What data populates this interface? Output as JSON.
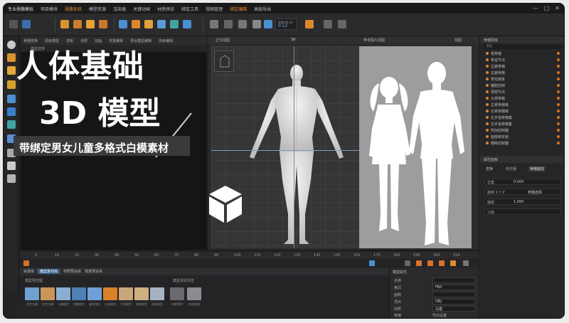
{
  "menubar": {
    "app_title": "专业骨骼模拟",
    "items": [
      "项目模块",
      "骨骼系统",
      "模型资源",
      "渲染器",
      "关键动画",
      "材质预设",
      "绑定工具",
      "视图管理",
      "绑定编辑",
      "高级导出"
    ],
    "highlight_index": 1
  },
  "toolbar": {
    "frame_display": "0:12",
    "frame_label": "帧数/00:12"
  },
  "viewport_left": {
    "tabs": [
      "骨骼变换",
      "层级模型",
      "渲染",
      "光照",
      "动画",
      "权重编辑",
      "预设模型编辑",
      "高级编辑"
    ],
    "sub_label": "模型选择"
  },
  "promo": {
    "title_line1": "人体基础",
    "title_line2": "3D 模型",
    "subtitle": "带绑定男女儿童多格式白模素材"
  },
  "viewport_main": {
    "left_label": "正交视图",
    "center_label": "3d",
    "right_label": "参考图片视图",
    "right_tag": "视图"
  },
  "outliner": {
    "title": "骨骼层级",
    "filter": "筛选",
    "items": [
      "根骨骼",
      "骨盆节点",
      "左腿骨骼",
      "右腿骨骼",
      "脊柱链条",
      "胸腔控制",
      "颈部节点",
      "头部骨骼",
      "左臂骨骼链",
      "右臂骨骼链",
      "左手指骨骼集",
      "右手指骨骼集",
      "附加控制器",
      "面部绑定组",
      "眼睛控制器"
    ]
  },
  "properties": {
    "title": "属性面板",
    "tabs": [
      "变换",
      "修改器",
      "骨骼属性"
    ],
    "rows": [
      "位置",
      "旋转 X Y Z",
      "缩放",
      "父级"
    ],
    "values": [
      "0.000",
      "骨骼选择",
      "1.000"
    ]
  },
  "timeline": {
    "ticks": [
      "0",
      "10",
      "20",
      "30",
      "40",
      "50",
      "60",
      "70",
      "80",
      "90",
      "100",
      "110",
      "120",
      "130",
      "140",
      "150",
      "160",
      "170",
      "180",
      "190",
      "200",
      "210"
    ]
  },
  "asset_browser": {
    "tabs": [
      "资源库",
      "模型素材库",
      "材质预设库",
      "场景预设库"
    ],
    "section_left": "模型预览图",
    "section_right": "模型资源浏览",
    "captions": [
      "男性白模",
      "女性白模",
      "儿童模型",
      "骨骼绑定",
      "姿势预设",
      "头部模型",
      "手部模型",
      "服装模型",
      "道具模型",
      "场景素材",
      "材质贴图"
    ]
  },
  "bottom_props": {
    "title": "模型属性",
    "rows": [
      "名称",
      "格式",
      "面数",
      "顶点",
      "材质",
      "骨骼",
      "导出设置"
    ],
    "values": [
      "FBX",
      "OBJ",
      "白模"
    ]
  },
  "colors": {
    "accent_orange": "#e0832a",
    "accent_blue": "#4a8fd0",
    "bg_dark": "#232325"
  }
}
